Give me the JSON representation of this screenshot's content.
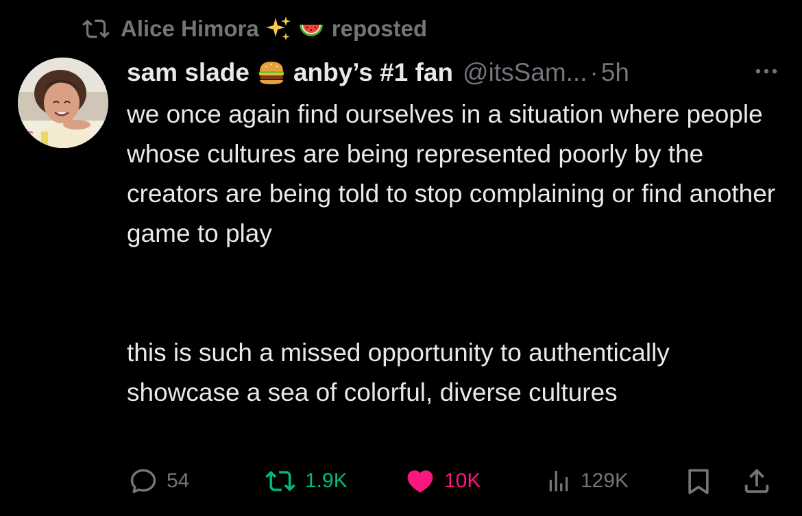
{
  "repost_line": {
    "reposter_name": "Alice Himora",
    "emojis": [
      "sparkles",
      "watermelon"
    ],
    "label": "reposted"
  },
  "tweet": {
    "display_name": "sam slade",
    "name_emoji": "hamburger",
    "name_suffix": "anby’s #1 fan",
    "handle": "@itsSam...",
    "separator": "·",
    "time": "5h",
    "paragraph_1": "we once again find ourselves in a situation where people whose cultures are being represented poorly by the creators are being told to stop complaining or find another game to play",
    "paragraph_2": "this is such a missed opportunity to authentically showcase a sea of colorful, diverse cultures"
  },
  "actions": {
    "replies": "54",
    "reposts": "1.9K",
    "likes": "10K",
    "views": "129K"
  },
  "colors": {
    "background": "#000000",
    "text": "#e7e9ea",
    "muted": "#71767b",
    "repost_active": "#00ba7c",
    "like_active": "#f91880"
  },
  "icons": [
    "repost-icon",
    "sparkles-icon",
    "watermelon-icon",
    "avatar",
    "hamburger-icon",
    "more-icon",
    "reply-icon",
    "repost-icon",
    "heart-icon",
    "views-icon",
    "bookmark-icon",
    "share-icon"
  ]
}
